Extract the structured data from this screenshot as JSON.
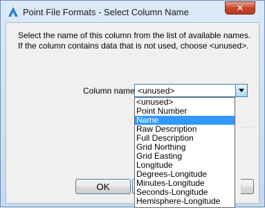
{
  "window": {
    "title": "Point File Formats - Select Column Name",
    "close_label": "✕"
  },
  "message": {
    "line1": "Select the name of this column from the list of available names.",
    "line2": "If the column contains data that is not used, choose <unused>."
  },
  "column_name": {
    "label": "Column name:",
    "value": "<unused>",
    "options": [
      "<unused>",
      "Point Number",
      "Name",
      "Raw Description",
      "Full Description",
      "Grid Northing",
      "Grid Easting",
      "Longitude",
      "Degrees-Longitude",
      "Minutes-Longitude",
      "Seconds-Longitude",
      "Hemisphere-Longitude"
    ],
    "highlighted_option": "Name"
  },
  "buttons": {
    "ok_label": "OK"
  },
  "colors": {
    "highlight": "#3399ff",
    "close_button": "#c9462c",
    "focus_border": "#3c7fb1"
  }
}
